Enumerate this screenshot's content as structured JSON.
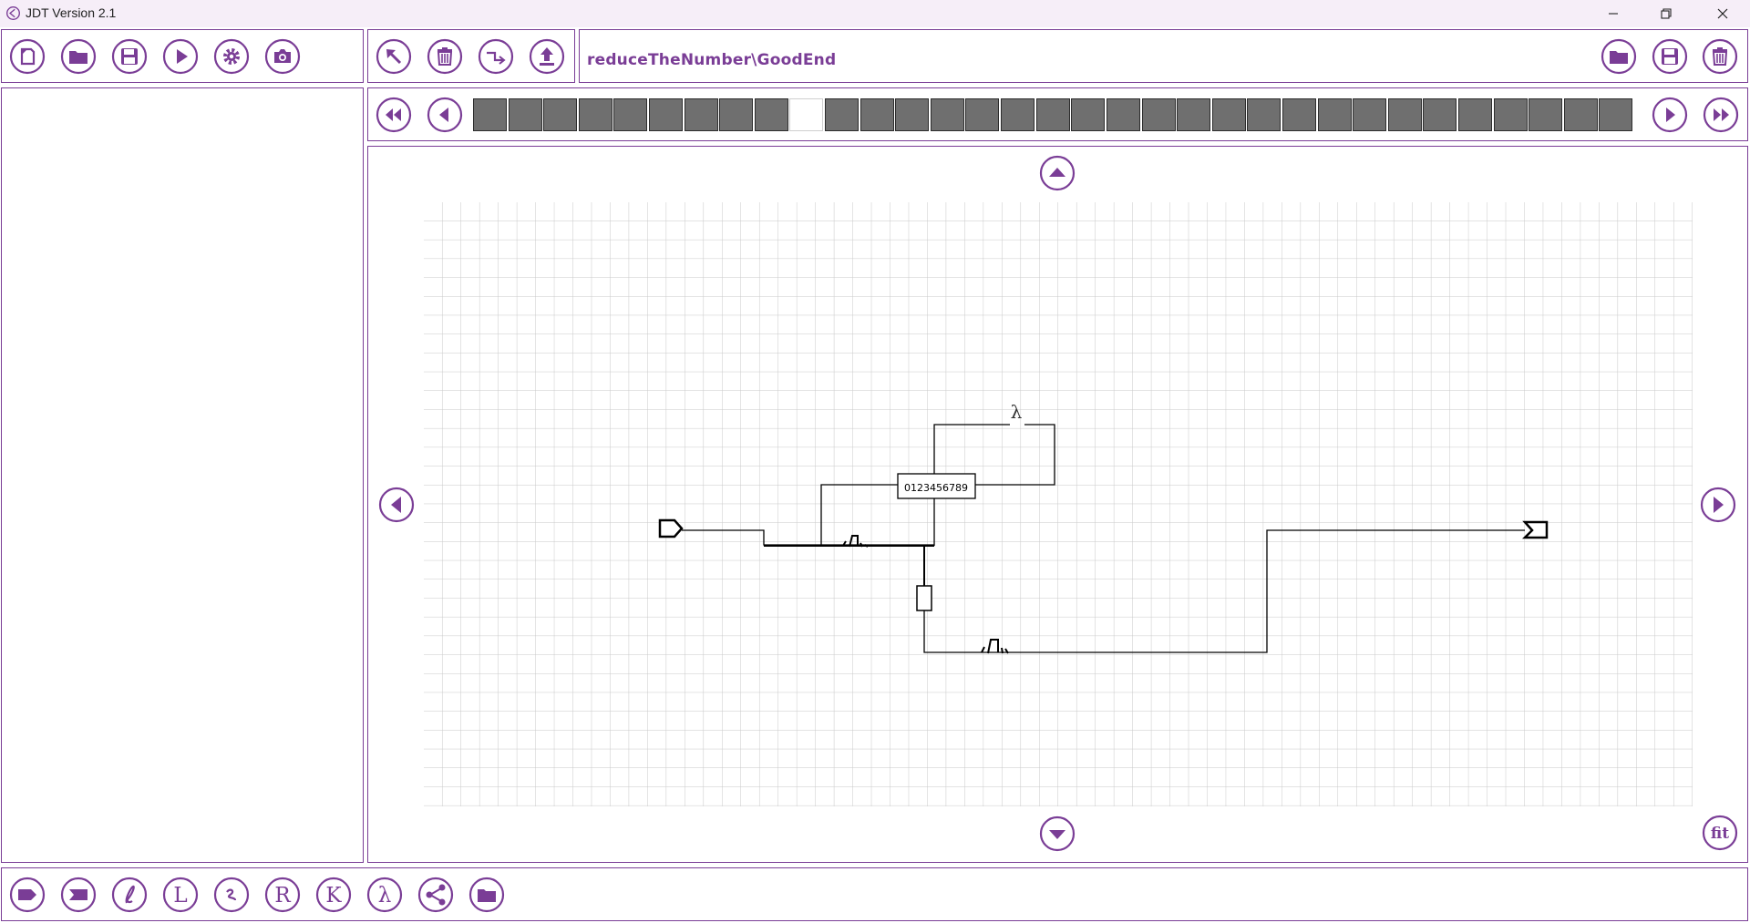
{
  "window": {
    "title": "JDT Version 2.1",
    "app_icon": "app-logo-icon",
    "controls": [
      "minimize-icon",
      "restore-icon",
      "close-icon"
    ]
  },
  "toolbar_left": {
    "buttons": [
      {
        "name": "new",
        "icon": "new-file-icon"
      },
      {
        "name": "open",
        "icon": "folder-open-icon"
      },
      {
        "name": "save",
        "icon": "save-icon"
      },
      {
        "name": "run",
        "icon": "play-icon"
      },
      {
        "name": "settings",
        "icon": "gear-icon"
      },
      {
        "name": "screenshot",
        "icon": "camera-icon"
      }
    ]
  },
  "toolbar_middle": {
    "buttons": [
      {
        "name": "select",
        "icon": "arrow-up-left-icon"
      },
      {
        "name": "delete",
        "icon": "trash-icon"
      },
      {
        "name": "route",
        "icon": "route-icon"
      },
      {
        "name": "upload",
        "icon": "upload-icon"
      }
    ]
  },
  "file_bar": {
    "path": "reduceTheNumber\\GoodEnd",
    "buttons": [
      {
        "name": "open",
        "icon": "folder-open-icon"
      },
      {
        "name": "save",
        "icon": "save-icon"
      },
      {
        "name": "delete",
        "icon": "trash-icon"
      }
    ]
  },
  "timeline": {
    "frame_count": 33,
    "active_frame": 9,
    "buttons": [
      "rewind-icon",
      "step-back-icon",
      "step-forward-icon",
      "fast-forward-icon"
    ]
  },
  "canvas": {
    "nav": [
      "pan-up-icon",
      "pan-down-icon",
      "pan-left-icon",
      "pan-right-icon"
    ],
    "fit_label": "fit",
    "tape_label": "0123456789",
    "lambda_label": "λ"
  },
  "bottom_toolbar": {
    "buttons": [
      {
        "name": "start-state",
        "icon": "start-state-icon"
      },
      {
        "name": "end-state",
        "icon": "end-state-icon"
      },
      {
        "name": "l-script",
        "icon": "l-script-icon"
      },
      {
        "name": "l-letter",
        "icon": "l-letter-icon",
        "glyph": "L"
      },
      {
        "name": "r-script",
        "icon": "r-script-icon"
      },
      {
        "name": "r-letter",
        "icon": "r-letter-icon",
        "glyph": "R"
      },
      {
        "name": "k-letter",
        "icon": "k-letter-icon",
        "glyph": "K"
      },
      {
        "name": "lambda",
        "icon": "lambda-icon",
        "glyph": "λ"
      },
      {
        "name": "share",
        "icon": "share-icon"
      },
      {
        "name": "folder",
        "icon": "folder-open-icon"
      }
    ]
  }
}
